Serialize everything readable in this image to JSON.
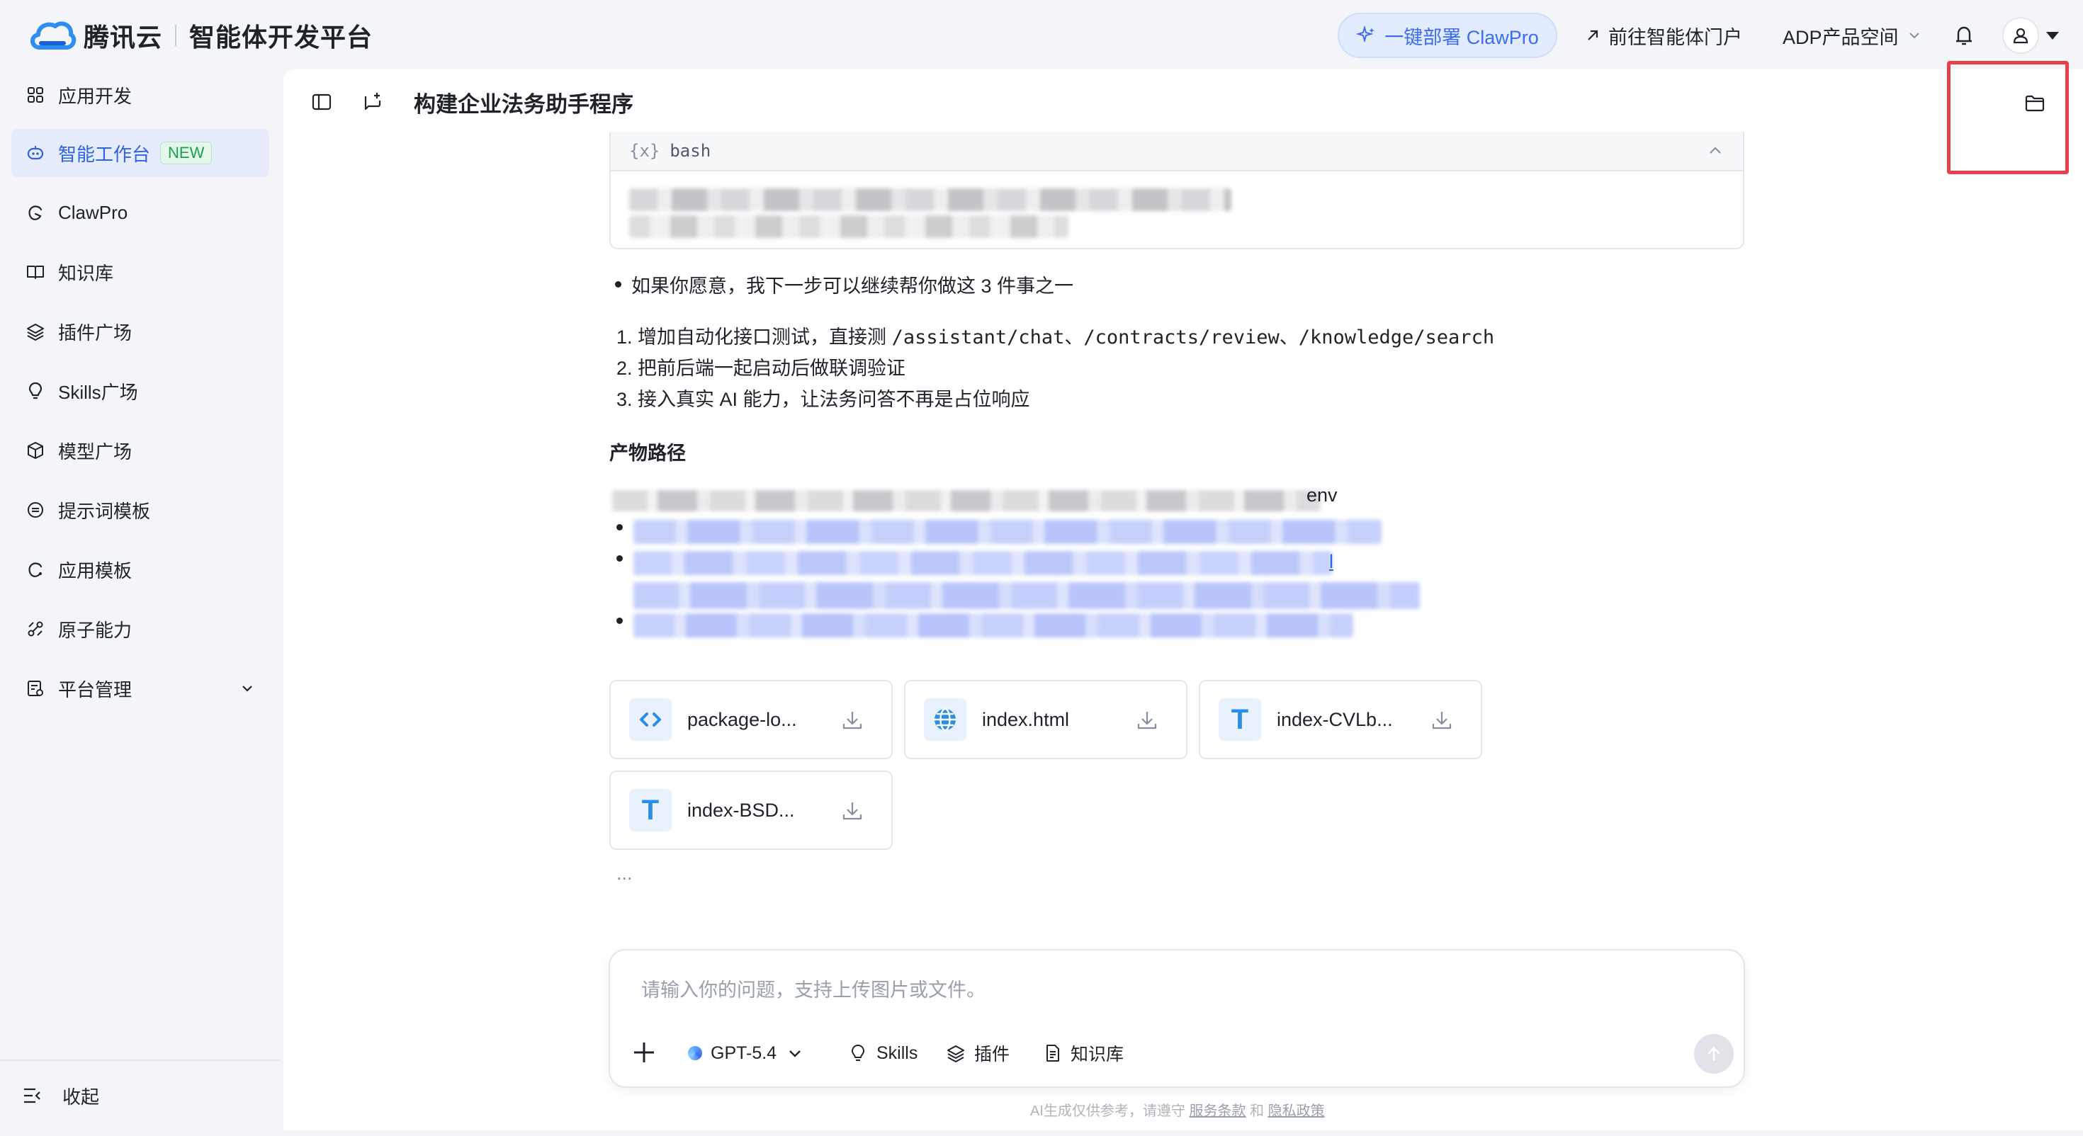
{
  "brand": {
    "name": "腾讯云",
    "product": "智能体开发平台"
  },
  "topbar": {
    "deploy_label": "一键部署 ClawPro",
    "portal_label": "前往智能体门户",
    "space_label": "ADP产品空间"
  },
  "sidebar": {
    "items": [
      {
        "label": "应用开发",
        "icon": "grid-icon"
      },
      {
        "label": "智能工作台",
        "icon": "bot-icon",
        "badge": "NEW",
        "active": true
      },
      {
        "label": "ClawPro",
        "icon": "claw-icon"
      },
      {
        "label": "知识库",
        "icon": "book-icon"
      },
      {
        "label": "插件广场",
        "icon": "layers-icon"
      },
      {
        "label": "Skills广场",
        "icon": "bulb-icon"
      },
      {
        "label": "模型广场",
        "icon": "cube-icon"
      },
      {
        "label": "提示词模板",
        "icon": "prompt-icon"
      },
      {
        "label": "应用模板",
        "icon": "template-icon"
      },
      {
        "label": "原子能力",
        "icon": "atom-icon"
      },
      {
        "label": "平台管理",
        "icon": "admin-icon",
        "expandable": true
      }
    ],
    "collapse_label": "收起"
  },
  "chat": {
    "title": "构建企业法务助手程序",
    "code_lang": "bash",
    "code_glyph": "{x}",
    "bullet_text": "如果你愿意，我下一步可以继续帮你做这 3 件事之一",
    "steps": [
      {
        "num": "1.",
        "text": "增加自动化接口测试，直接测 ",
        "code": "/assistant/chat、/contracts/review、/knowledge/search"
      },
      {
        "num": "2.",
        "text": "把前后端一起启动后做联调验证",
        "code": ""
      },
      {
        "num": "3.",
        "text": "接入真实 AI 能力，让法务问答不再是占位响应",
        "code": ""
      }
    ],
    "artifacts_heading": "产物路径",
    "path_tail": "env",
    "link_tail": "l",
    "ellipsis": "...",
    "files": [
      {
        "name": "package-lo...",
        "icon": "code-icon"
      },
      {
        "name": "index.html",
        "icon": "globe-icon"
      },
      {
        "name": "index-CVLb...",
        "icon": "text-icon",
        "glyph": "T"
      },
      {
        "name": "index-BSD...",
        "icon": "text-icon",
        "glyph": "T"
      }
    ]
  },
  "composer": {
    "placeholder": "请输入你的问题，支持上传图片或文件。",
    "model_label": "GPT-5.4",
    "skills_label": "Skills",
    "plugin_label": "插件",
    "kb_label": "知识库"
  },
  "footer": {
    "disclaimer_prefix": "AI生成仅供参考，请遵守",
    "terms_label": "服务条款",
    "and_label": "和",
    "privacy_label": "隐私政策"
  },
  "colors": {
    "accent": "#2e63e6",
    "highlight": "#e8404a",
    "badge_green": "#17a34a"
  }
}
